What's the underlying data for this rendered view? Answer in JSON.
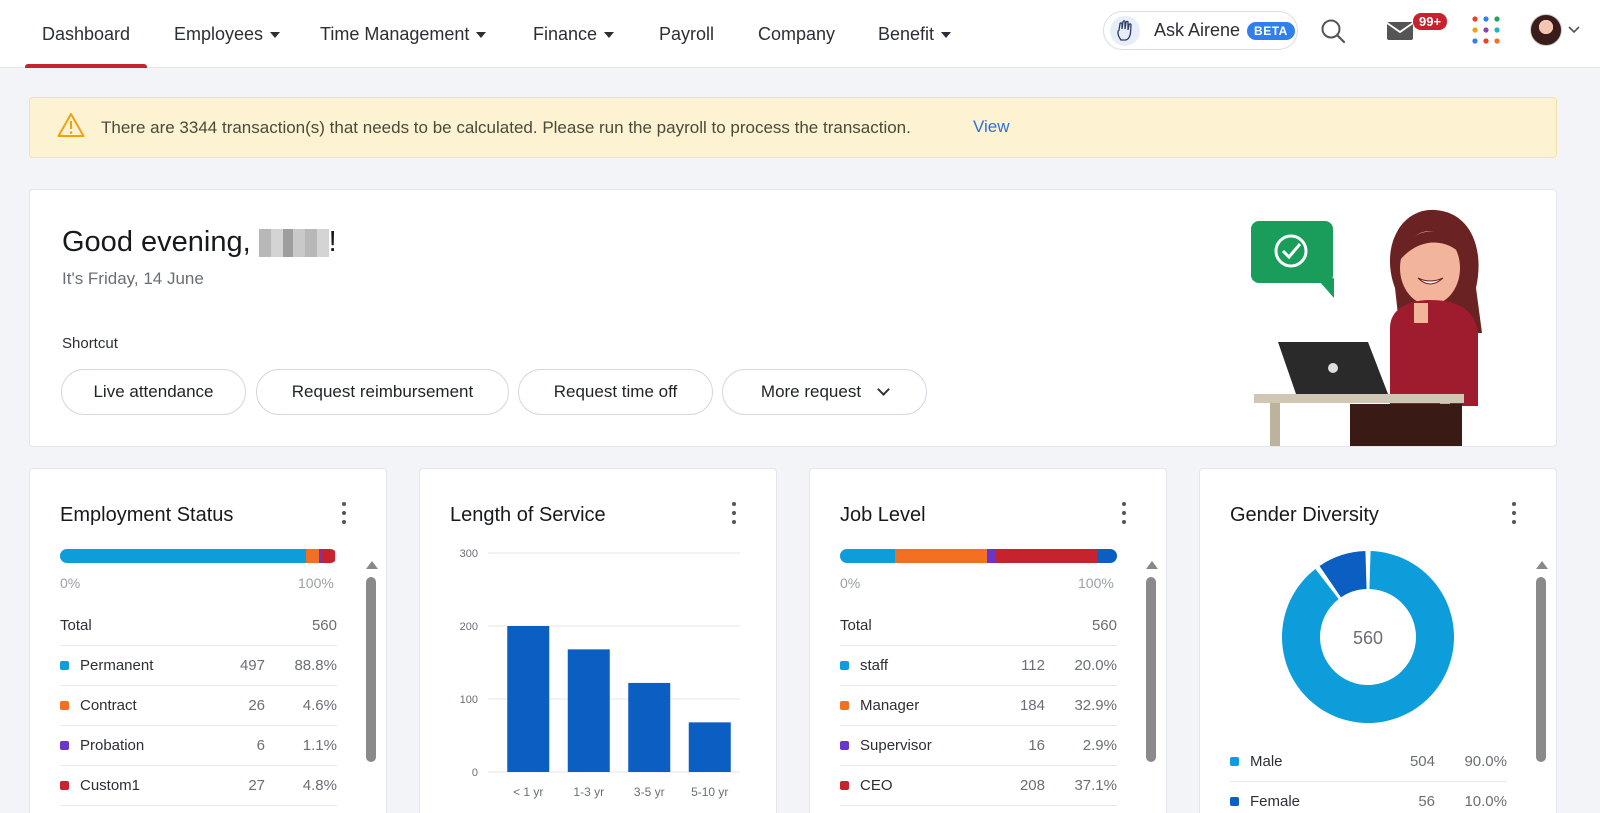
{
  "nav": {
    "items": [
      {
        "label": "Dashboard",
        "dropdown": false,
        "active": true
      },
      {
        "label": "Employees",
        "dropdown": true
      },
      {
        "label": "Time Management",
        "dropdown": true
      },
      {
        "label": "Finance",
        "dropdown": true
      },
      {
        "label": "Payroll",
        "dropdown": false
      },
      {
        "label": "Company",
        "dropdown": false
      },
      {
        "label": "Benefit",
        "dropdown": true
      }
    ],
    "ask_label": "Ask Airene",
    "beta": "BETA",
    "notification_count": "99+"
  },
  "alert": {
    "message": "There are 3344 transaction(s) that needs to be calculated. Please run the payroll to process the transaction.",
    "link": "View"
  },
  "greeting": {
    "title": "Good evening,",
    "suffix": "!",
    "date": "It's Friday, 14 June",
    "shortcut_label": "Shortcut",
    "shortcuts": [
      "Live attendance",
      "Request reimbursement",
      "Request time off",
      "More request"
    ]
  },
  "employment_status": {
    "title": "Employment Status",
    "axis_min": "0%",
    "axis_max": "100%",
    "total_label": "Total",
    "total": "560",
    "rows": [
      {
        "name": "Permanent",
        "count": "497",
        "pct": "88.8%",
        "color": "#0d9ddb"
      },
      {
        "name": "Contract",
        "count": "26",
        "pct": "4.6%",
        "color": "#f36f21"
      },
      {
        "name": "Probation",
        "count": "6",
        "pct": "1.1%",
        "color": "#6a35c9"
      },
      {
        "name": "Custom1",
        "count": "27",
        "pct": "4.8%",
        "color": "#c7232f"
      }
    ]
  },
  "length_of_service": {
    "title": "Length of Service",
    "chart_data": {
      "type": "bar",
      "categories": [
        "< 1 yr",
        "1-3 yr",
        "3-5 yr",
        "5-10 yr"
      ],
      "values": [
        200,
        168,
        122,
        68
      ],
      "ylim": [
        0,
        300
      ],
      "yticks": [
        0,
        100,
        200,
        300
      ],
      "color": "#0b5ec2",
      "grid": true
    }
  },
  "job_level": {
    "title": "Job Level",
    "axis_min": "0%",
    "axis_max": "100%",
    "total_label": "Total",
    "total": "560",
    "rows": [
      {
        "name": "staff",
        "count": "112",
        "pct": "20.0%",
        "color": "#0d9ddb"
      },
      {
        "name": "Manager",
        "count": "184",
        "pct": "32.9%",
        "color": "#f36f21"
      },
      {
        "name": "Supervisor",
        "count": "16",
        "pct": "2.9%",
        "color": "#6a35c9"
      },
      {
        "name": "CEO",
        "count": "208",
        "pct": "37.1%",
        "color": "#c7232f"
      }
    ],
    "extra_segment": {
      "pct": 7.1,
      "color": "#0b5ec2"
    }
  },
  "gender_diversity": {
    "title": "Gender Diversity",
    "center": "560",
    "rows": [
      {
        "name": "Male",
        "count": "504",
        "pct": "90.0%",
        "value": 90.0,
        "color": "#0d9ddb"
      },
      {
        "name": "Female",
        "count": "56",
        "pct": "10.0%",
        "value": 10.0,
        "color": "#0b5ec2"
      }
    ]
  }
}
